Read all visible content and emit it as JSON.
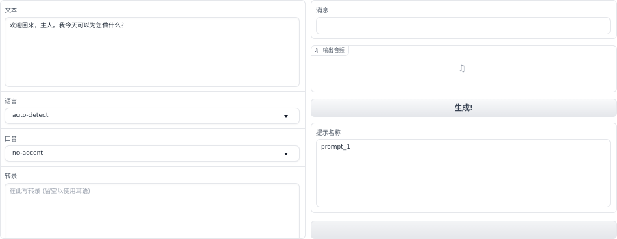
{
  "text_section": {
    "label": "文本",
    "value": "欢迎回来，主人。我今天可以为您做什么？"
  },
  "language_section": {
    "label": "语言",
    "selected": "auto-detect"
  },
  "accent_section": {
    "label": "口音",
    "selected": "no-accent"
  },
  "transcript_section": {
    "label": "转录",
    "placeholder": "在此写转录 (留空以使用耳语)"
  },
  "message_section": {
    "label": "消息",
    "value": ""
  },
  "audio_output": {
    "label": "输出音频",
    "note_icon": "♫",
    "placeholder_icon": "♫"
  },
  "generate_button": {
    "label": "生成!"
  },
  "prompt_section": {
    "label": "提示名称",
    "value": "prompt_1"
  }
}
